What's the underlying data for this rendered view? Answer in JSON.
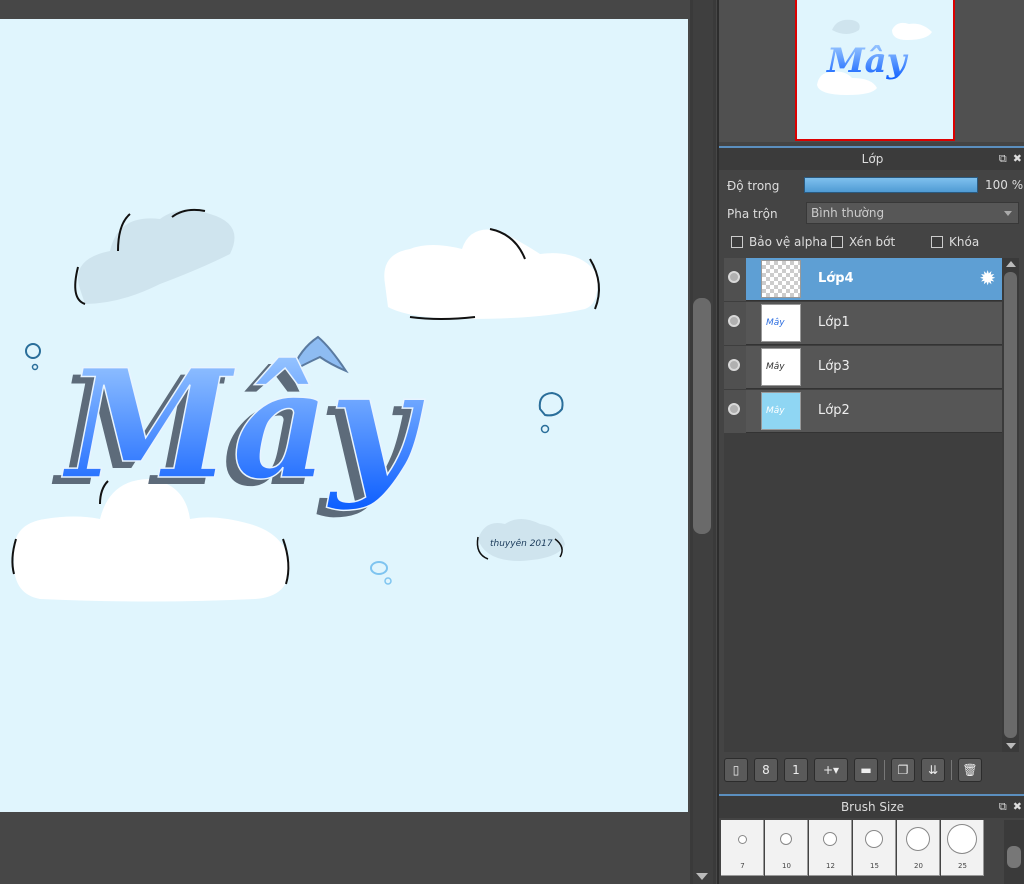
{
  "canvas": {
    "artwork_title": "Mây",
    "signature": "thuyyên 2017"
  },
  "layers_panel": {
    "title": "Lớp",
    "opacity_label": "Độ trong",
    "opacity_value": "100 %",
    "opacity_fraction": 1.0,
    "blend_label": "Pha trộn",
    "blend_mode": "Bình thường",
    "protect_alpha_label": "Bảo vệ alpha",
    "clipping_label": "Xén bớt",
    "lock_label": "Khóa",
    "layers": [
      {
        "name": "Lớp4",
        "selected": true,
        "thumb": "checker"
      },
      {
        "name": "Lớp1",
        "selected": false,
        "thumb": "white",
        "thumb_text": "Mây"
      },
      {
        "name": "Lớp3",
        "selected": false,
        "thumb": "white",
        "thumb_text": "Mây"
      },
      {
        "name": "Lớp2",
        "selected": false,
        "thumb": "blue",
        "thumb_text": "Mây"
      }
    ]
  },
  "brush_panel": {
    "title": "Brush Size",
    "sizes": [
      "7",
      "10",
      "12",
      "15",
      "20",
      "25"
    ]
  },
  "colors": {
    "accent": "#5e9fd4",
    "artboard": "#e0f5fd",
    "panel": "#444444"
  },
  "icons": {
    "header_float": "popout-icon",
    "header_close": "close-icon",
    "layer_settings": "gear-icon"
  }
}
